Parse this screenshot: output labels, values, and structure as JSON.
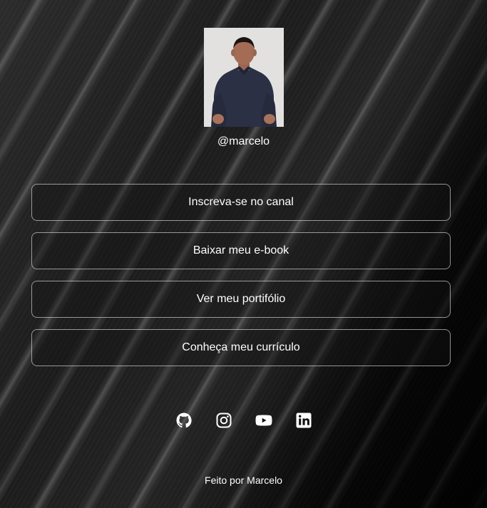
{
  "profile": {
    "handle": "@marcelo"
  },
  "links": [
    {
      "label": "Inscreva-se no canal"
    },
    {
      "label": "Baixar meu e-book"
    },
    {
      "label": "Ver meu portifólio"
    },
    {
      "label": "Conheça meu currículo"
    }
  ],
  "socials": [
    {
      "icon": "github-icon"
    },
    {
      "icon": "instagram-icon"
    },
    {
      "icon": "youtube-icon"
    },
    {
      "icon": "linkedin-icon"
    }
  ],
  "footer": {
    "text": "Feito por Marcelo"
  },
  "colors": {
    "text": "#ffffff",
    "background": "#0b0b0b",
    "button_border": "#8c8c8c"
  }
}
